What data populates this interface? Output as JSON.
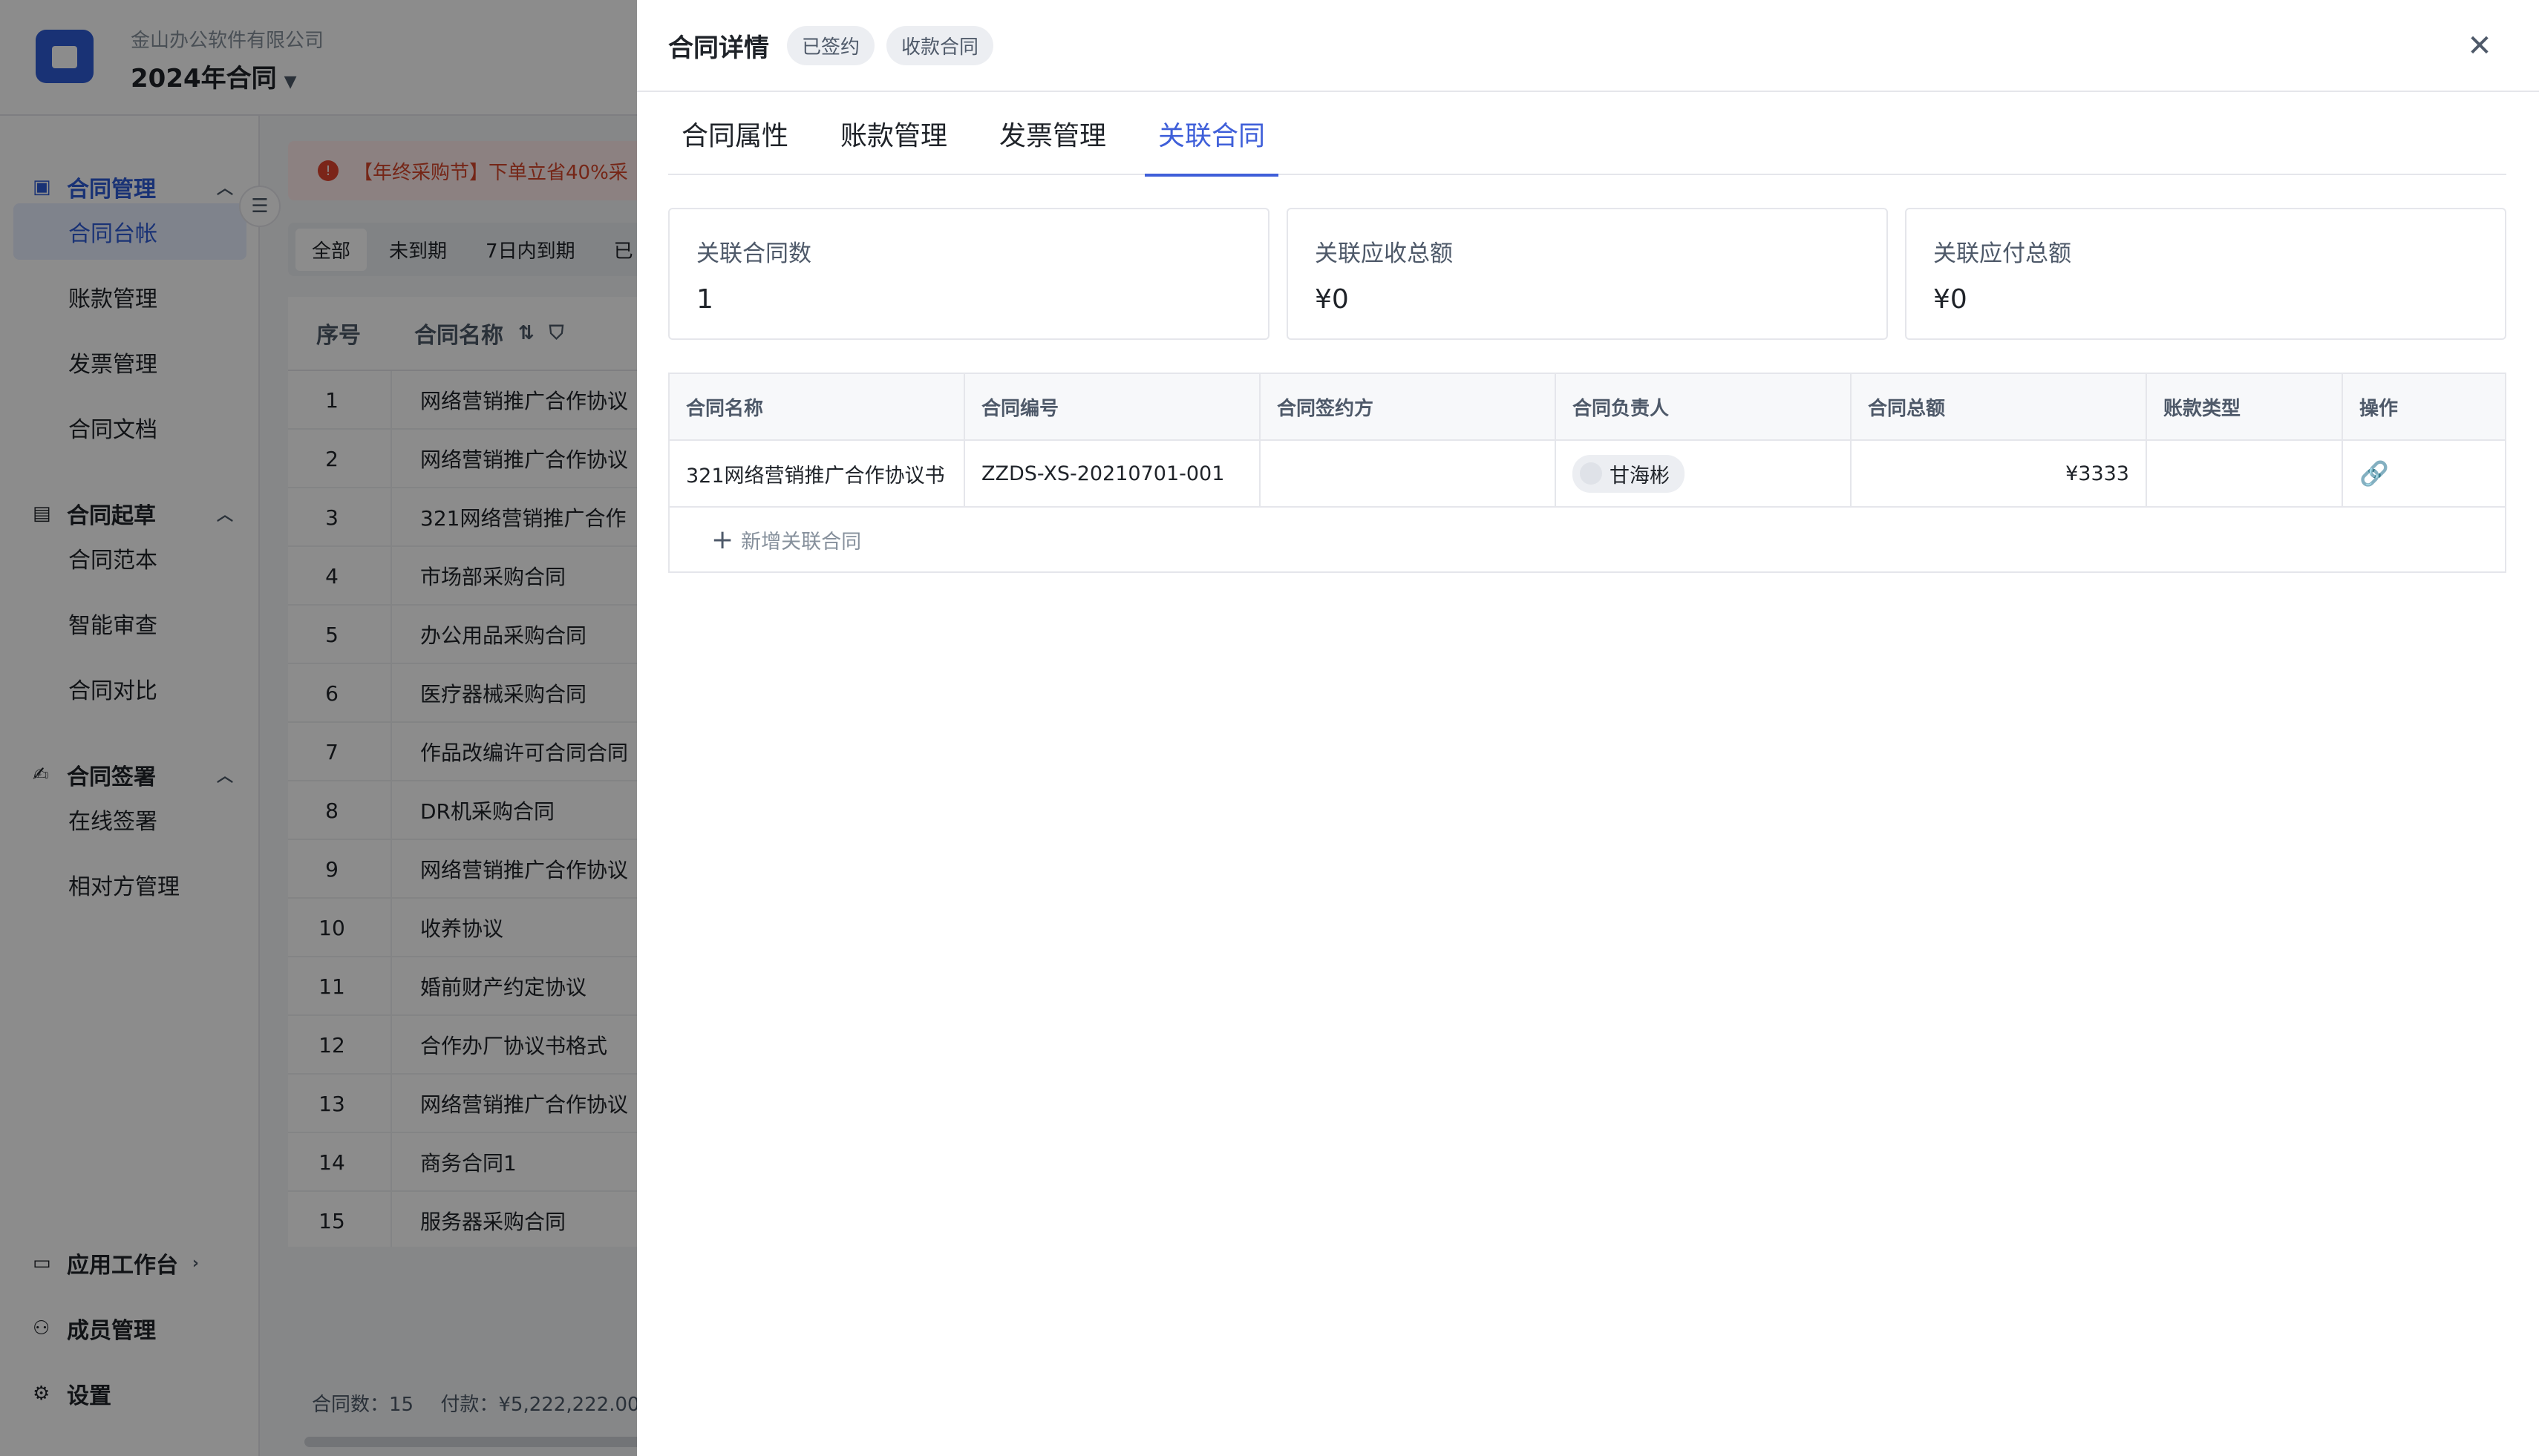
{
  "app": {
    "company": "金山办公软件有限公司",
    "project_title": "2024年合同"
  },
  "sidebar": {
    "groups": [
      {
        "label": "合同管理",
        "items": [
          "合同台帐",
          "账款管理",
          "发票管理",
          "合同文档"
        ]
      },
      {
        "label": "合同起草",
        "items": [
          "合同范本",
          "智能审查",
          "合同对比"
        ]
      },
      {
        "label": "合同签署",
        "items": [
          "在线签署",
          "相对方管理"
        ]
      }
    ],
    "bottom": [
      "应用工作台",
      "成员管理",
      "设置"
    ]
  },
  "list": {
    "banner": "【年终采购节】下单立省40%采",
    "filters": [
      "全部",
      "未到期",
      "7日内到期",
      "已"
    ],
    "columns": [
      "序号",
      "合同名称"
    ],
    "rows": [
      [
        "1",
        "网络营销推广合作协议"
      ],
      [
        "2",
        "网络营销推广合作协议"
      ],
      [
        "3",
        "321网络营销推广合作"
      ],
      [
        "4",
        "市场部采购合同"
      ],
      [
        "5",
        "办公用品采购合同"
      ],
      [
        "6",
        "医疗器械采购合同"
      ],
      [
        "7",
        "作品改编许可合同合同"
      ],
      [
        "8",
        "DR机采购合同"
      ],
      [
        "9",
        "网络营销推广合作协议"
      ],
      [
        "10",
        "收养协议"
      ],
      [
        "11",
        "婚前财产约定协议"
      ],
      [
        "12",
        "合作办厂协议书格式"
      ],
      [
        "13",
        "网络营销推广合作协议"
      ],
      [
        "14",
        "商务合同1"
      ],
      [
        "15",
        "服务器采购合同"
      ]
    ],
    "footer_count": "合同数：15",
    "footer_pay": "付款：¥5,222,222.00"
  },
  "drawer": {
    "title": "合同详情",
    "tags": [
      "已签约",
      "收款合同"
    ],
    "tabs": [
      "合同属性",
      "账款管理",
      "发票管理",
      "关联合同"
    ],
    "active_tab": "关联合同",
    "stats": [
      {
        "label": "关联合同数",
        "value": "1"
      },
      {
        "label": "关联应收总额",
        "value": "¥0"
      },
      {
        "label": "关联应付总额",
        "value": "¥0"
      }
    ],
    "table": {
      "columns": [
        "合同名称",
        "合同编号",
        "合同签约方",
        "合同负责人",
        "合同总额",
        "账款类型",
        "操作"
      ],
      "rows": [
        {
          "name": "321网络营销推广合作协议书",
          "code": "ZZDS-XS-20210701-001",
          "party": "",
          "owner": "甘海彬",
          "amount": "¥3333",
          "account_type": ""
        }
      ],
      "add_label": "新增关联合同"
    }
  },
  "colors": {
    "accent": "#3f5fd9",
    "banner_text": "#d6452b"
  }
}
